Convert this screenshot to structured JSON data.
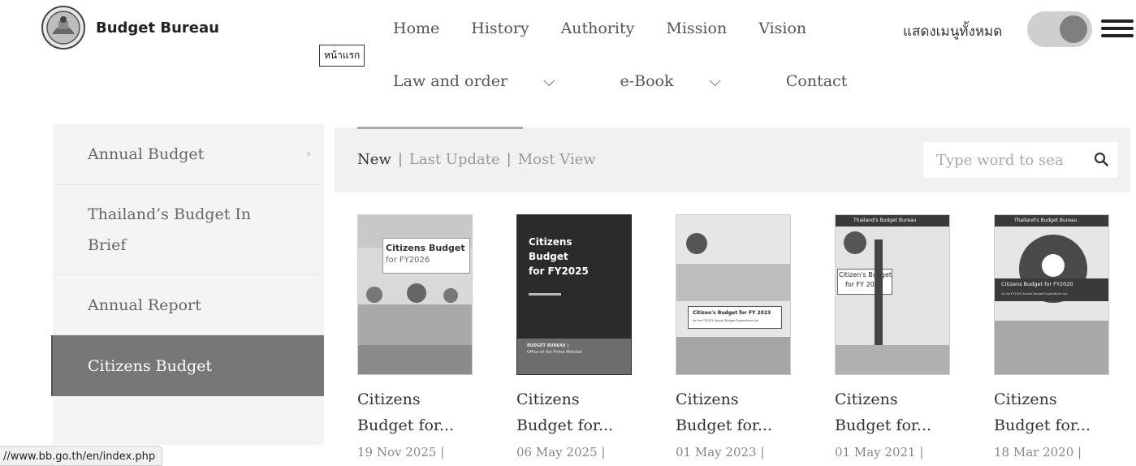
{
  "header": {
    "brand": "Budget Bureau",
    "home_tooltip": "หน้าแรก",
    "nav_row1": [
      "Home",
      "History",
      "Authority",
      "Mission",
      "Vision"
    ],
    "nav_row2": [
      {
        "label": "Law and order",
        "dropdown": true
      },
      {
        "label": "e-Book",
        "dropdown": true
      },
      {
        "label": "Contact",
        "dropdown": false
      }
    ],
    "show_all_menu": "แสดงเมนูทั้งหมด"
  },
  "sidebar": {
    "items": [
      {
        "label": "Annual Budget",
        "has_submenu": true
      },
      {
        "label": "Thailand’s Budget In Brief",
        "line1": "Thailand’s Budget In",
        "line2": "Brief"
      },
      {
        "label": "Annual Report"
      },
      {
        "label": "Citizens Budget",
        "active": true
      }
    ]
  },
  "tabs": {
    "new": "New",
    "last_update": "Last Update",
    "most_view": "Most View"
  },
  "search": {
    "placeholder": "Type word to sea"
  },
  "cards": [
    {
      "title1": "Citizens",
      "title2": "Budget for...",
      "date": "19 Nov 2025  |",
      "cover_title": "Citizens Budget",
      "cover_sub": "for FY2026"
    },
    {
      "title1": "Citizens",
      "title2": "Budget for...",
      "date": "06 May 2025  |",
      "cover_title": "Citizens",
      "cover_title2": "Budget",
      "cover_sub": "for FY2025",
      "cover_footer": "BUDGET BUREAU |",
      "cover_footer2": "Office of the Prime Minister"
    },
    {
      "title1": "Citizens",
      "title2": "Budget for...",
      "date": "01 May 2023  |",
      "cover_title": "Citizen's Budget for FY 2023",
      "cover_sub": "As the FY2023 Annual Budget Expenditure Act"
    },
    {
      "title1": "Citizens",
      "title2": "Budget for...",
      "date": "01 May 2021  |",
      "cover_header": "Thailand's Budget Bureau",
      "cover_title": "Citizen's Budget",
      "cover_sub": "for FY 2021"
    },
    {
      "title1": "Citizens",
      "title2": "Budget for...",
      "date": "18 Mar 2020  |",
      "cover_header": "Thailand's Budget Bureau",
      "cover_title": "Citizens Budget for FY2020",
      "cover_sub": "As the FY2020 Annual Budget Expenditure Act"
    }
  ],
  "status_url": "//www.bb.go.th/en/index.php"
}
